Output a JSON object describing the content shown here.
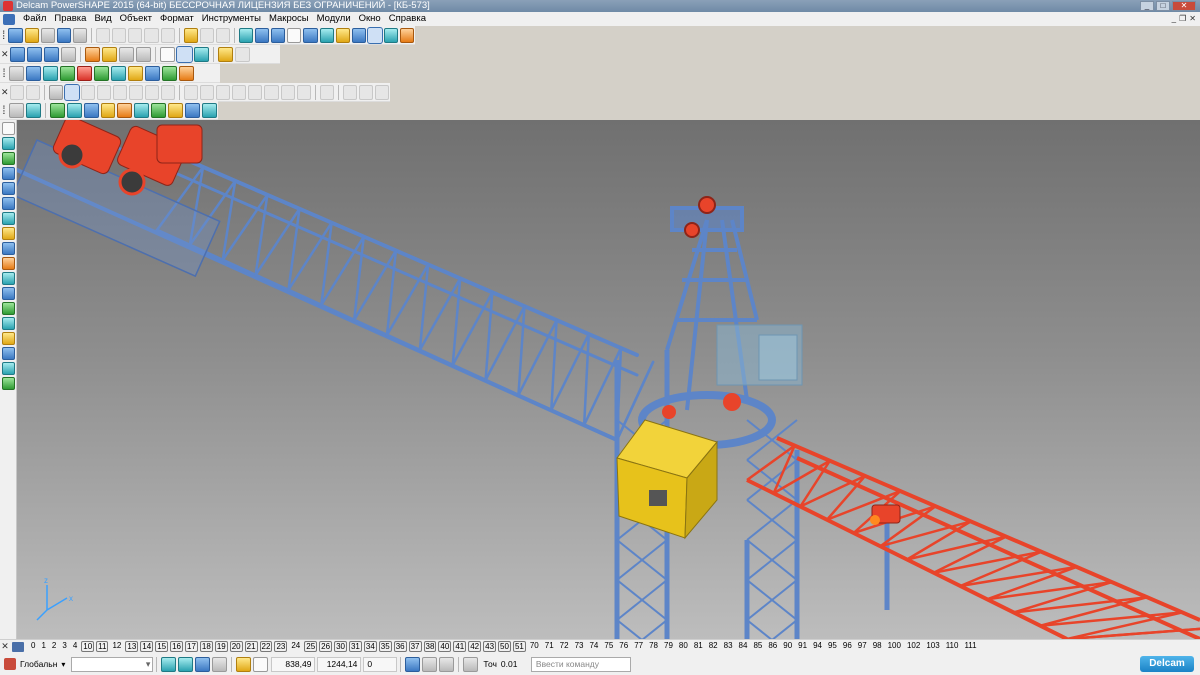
{
  "window": {
    "title": "Delcam PowerSHAPE 2015 (64-bit) БЕССРОЧНАЯ ЛИЦЕНЗИЯ БЕЗ ОГРАНИЧЕНИЙ - [КБ-573]"
  },
  "menu": {
    "items": [
      "Файл",
      "Правка",
      "Вид",
      "Объект",
      "Формат",
      "Инструменты",
      "Макросы",
      "Модули",
      "Окно",
      "Справка"
    ]
  },
  "levels": {
    "items": [
      "0",
      "1",
      "2",
      "3",
      "4",
      "10",
      "11",
      "12",
      "13",
      "14",
      "15",
      "16",
      "17",
      "18",
      "19",
      "20",
      "21",
      "22",
      "23",
      "24",
      "25",
      "26",
      "30",
      "31",
      "34",
      "35",
      "36",
      "37",
      "38",
      "40",
      "41",
      "42",
      "43",
      "50",
      "51",
      "70",
      "71",
      "72",
      "73",
      "74",
      "75",
      "76",
      "77",
      "78",
      "79",
      "80",
      "81",
      "82",
      "83",
      "84",
      "85",
      "86",
      "90",
      "91",
      "94",
      "95",
      "96",
      "97",
      "98",
      "100",
      "102",
      "103",
      "110",
      "111"
    ],
    "boxed": [
      "10",
      "11",
      "13",
      "14",
      "15",
      "16",
      "17",
      "18",
      "19",
      "20",
      "21",
      "22",
      "23",
      "25",
      "26",
      "30",
      "31",
      "34",
      "35",
      "36",
      "37",
      "38",
      "40",
      "41",
      "42",
      "43",
      "50",
      "51"
    ]
  },
  "status": {
    "workspace": "Глобальн",
    "x": "838,49",
    "y": "1244,14",
    "z": "0",
    "tolerance_label": "Точ",
    "tolerance_value": "0.01",
    "command_placeholder": "Ввести команду",
    "brand": "Delcam"
  },
  "colors": {
    "steel_blue": "#5d85c8",
    "jib_red": "#e8442a",
    "cab_yellow": "#e7c21b",
    "viewport_top": "#707070",
    "viewport_bottom": "#bdbdbd"
  }
}
